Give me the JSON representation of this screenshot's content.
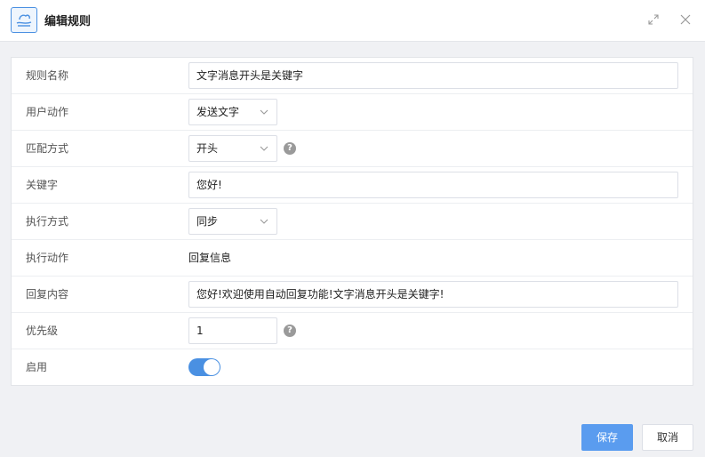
{
  "dialog": {
    "title": "编辑规则",
    "icon": "cloud-hand-icon",
    "expand_icon": "expand-icon",
    "close_icon": "close-icon"
  },
  "form": {
    "rule_name": {
      "label": "规则名称",
      "value": "文字消息开头是关键字"
    },
    "user_action": {
      "label": "用户动作",
      "value": "发送文字"
    },
    "match_mode": {
      "label": "匹配方式",
      "value": "开头",
      "help": "?"
    },
    "keyword": {
      "label": "关键字",
      "value": "您好!"
    },
    "exec_mode": {
      "label": "执行方式",
      "value": "同步"
    },
    "exec_action": {
      "label": "执行动作",
      "value": "回复信息"
    },
    "reply_content": {
      "label": "回复内容",
      "value": "您好!欢迎使用自动回复功能!文字消息开头是关键字!"
    },
    "priority": {
      "label": "优先级",
      "value": "1",
      "help": "?"
    },
    "enabled": {
      "label": "启用",
      "state": true
    }
  },
  "footer": {
    "save_label": "保存",
    "cancel_label": "取消"
  },
  "colors": {
    "accent": "#4a90e2",
    "save_button": "#5a9cef",
    "help_icon": "#9a9a9a"
  }
}
